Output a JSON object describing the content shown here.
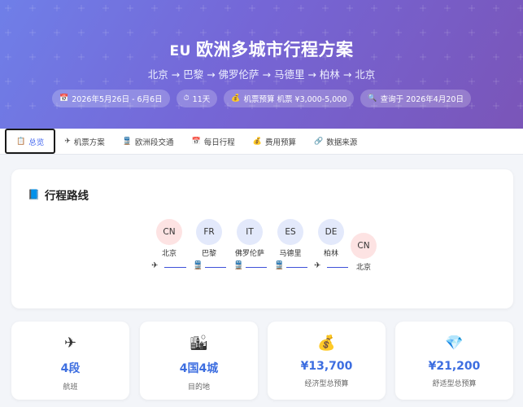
{
  "hero": {
    "flag": "EU",
    "title": "欧洲多城市行程方案",
    "route": "北京 → 巴黎 → 佛罗伦萨 → 马德里 → 柏林 → 北京",
    "chips": [
      {
        "icon": "📅",
        "icon_name": "calendar-icon",
        "text": "2026年5月26日 - 6月6日"
      },
      {
        "icon": "⏱",
        "icon_name": "stopwatch-icon",
        "text": "11天"
      },
      {
        "icon": "💰",
        "icon_name": "money-bag-icon",
        "text": "机票预算 机票 ¥3,000-5,000"
      },
      {
        "icon": "🔍",
        "icon_name": "search-icon",
        "text": "查询于 2026年4月20日"
      }
    ]
  },
  "tabs": [
    {
      "icon": "📋",
      "icon_name": "clipboard-icon",
      "label": "总览",
      "active": true
    },
    {
      "icon": "✈",
      "icon_name": "airplane-icon",
      "label": "机票方案"
    },
    {
      "icon": "🚆",
      "icon_name": "train-icon",
      "label": "欧洲段交通"
    },
    {
      "icon": "📅",
      "icon_name": "calendar-icon",
      "label": "每日行程"
    },
    {
      "icon": "💰",
      "icon_name": "money-bag-icon",
      "label": "费用预算"
    },
    {
      "icon": "🔗",
      "icon_name": "link-icon",
      "label": "数据来源"
    }
  ],
  "route_section": {
    "icon": "📘",
    "icon_name": "book-icon",
    "title": "行程路线",
    "cities": [
      {
        "code": "CN",
        "name": "北京"
      },
      {
        "code": "FR",
        "name": "巴黎"
      },
      {
        "code": "IT",
        "name": "佛罗伦萨"
      },
      {
        "code": "ES",
        "name": "马德里"
      },
      {
        "code": "DE",
        "name": "柏林"
      },
      {
        "code": "CN",
        "name": "北京"
      }
    ],
    "legs": [
      {
        "icon": "✈",
        "icon_name": "airplane-icon"
      },
      {
        "icon": "🚆",
        "icon_name": "train-icon"
      },
      {
        "icon": "🚆",
        "icon_name": "train-icon"
      },
      {
        "icon": "🚆",
        "icon_name": "train-icon"
      },
      {
        "icon": "✈",
        "icon_name": "airplane-icon"
      }
    ]
  },
  "stats": [
    {
      "icon": "✈",
      "icon_name": "airplane-icon",
      "value": "4段",
      "label": "航班"
    },
    {
      "icon": "🏙",
      "icon_name": "cityscape-icon",
      "value": "4国4城",
      "label": "目的地"
    },
    {
      "icon": "💰",
      "icon_name": "money-bag-icon",
      "value": "¥13,700",
      "label": "经济型总预算"
    },
    {
      "icon": "💎",
      "icon_name": "gem-icon",
      "value": "¥21,200",
      "label": "舒适型总预算"
    }
  ],
  "colors": {
    "accent": "#3d6ee0",
    "hero_start": "#6f7fe8",
    "hero_end": "#7a55b8"
  }
}
